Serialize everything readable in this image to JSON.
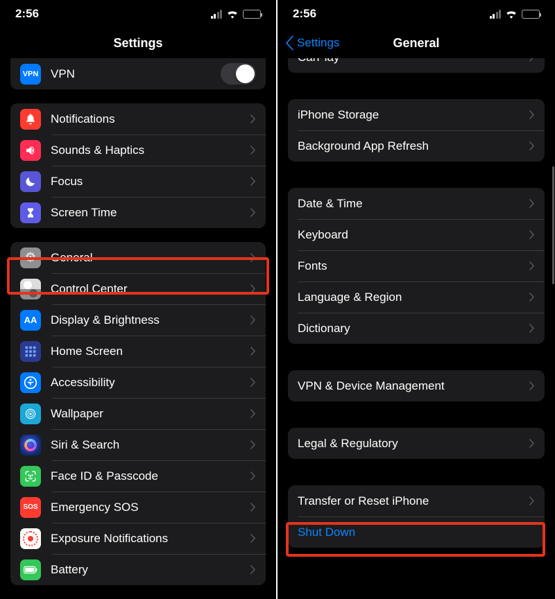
{
  "status": {
    "time": "2:56",
    "signal_level": 2,
    "wifi": true,
    "battery_pct": 45,
    "battery_color": "#ffcc00"
  },
  "left": {
    "title": "Settings",
    "vpn": {
      "label": "VPN",
      "icon_text": "VPN",
      "on": false
    },
    "groups": [
      [
        {
          "key": "notifications",
          "label": "Notifications",
          "icon": "bell-icon",
          "bg": "bg-red"
        },
        {
          "key": "sounds-haptics",
          "label": "Sounds & Haptics",
          "icon": "speaker-icon",
          "bg": "bg-pink"
        },
        {
          "key": "focus",
          "label": "Focus",
          "icon": "moon-icon",
          "bg": "bg-indigo"
        },
        {
          "key": "screen-time",
          "label": "Screen Time",
          "icon": "hourglass-icon",
          "bg": "bg-violet"
        }
      ],
      [
        {
          "key": "general",
          "label": "General",
          "icon": "gear-icon",
          "bg": "bg-gray",
          "highlighted": true
        },
        {
          "key": "control-center",
          "label": "Control Center",
          "icon": "switches-icon",
          "bg": "bg-gray"
        },
        {
          "key": "display-brightness",
          "label": "Display & Brightness",
          "icon": "text-size-icon",
          "bg": "bg-blue",
          "glyph": "AA"
        },
        {
          "key": "home-screen",
          "label": "Home Screen",
          "icon": "apps-grid-icon",
          "bg": "bg-bluealt"
        },
        {
          "key": "accessibility",
          "label": "Accessibility",
          "icon": "accessibility-icon",
          "bg": "bg-blue"
        },
        {
          "key": "wallpaper",
          "label": "Wallpaper",
          "icon": "wallpaper-icon",
          "bg": "bg-cyan"
        },
        {
          "key": "siri-search",
          "label": "Siri & Search",
          "icon": "siri-icon",
          "bg": "bg-black"
        },
        {
          "key": "face-id",
          "label": "Face ID & Passcode",
          "icon": "faceid-icon",
          "bg": "bg-green"
        },
        {
          "key": "emergency-sos",
          "label": "Emergency SOS",
          "icon": "sos-icon",
          "bg": "bg-red",
          "glyph": "SOS"
        },
        {
          "key": "exposure",
          "label": "Exposure Notifications",
          "icon": "exposure-icon",
          "bg": "bg-white"
        },
        {
          "key": "battery",
          "label": "Battery",
          "icon": "battery-icon",
          "bg": "bg-green"
        }
      ]
    ]
  },
  "right": {
    "back_label": "Settings",
    "title": "General",
    "groups": [
      [
        {
          "key": "carplay",
          "label": "CarPlay"
        }
      ],
      [
        {
          "key": "iphone-storage",
          "label": "iPhone Storage"
        },
        {
          "key": "background-app-refresh",
          "label": "Background App Refresh"
        }
      ],
      [
        {
          "key": "date-time",
          "label": "Date & Time"
        },
        {
          "key": "keyboard",
          "label": "Keyboard"
        },
        {
          "key": "fonts",
          "label": "Fonts"
        },
        {
          "key": "language-region",
          "label": "Language & Region"
        },
        {
          "key": "dictionary",
          "label": "Dictionary"
        }
      ],
      [
        {
          "key": "vpn-device-mgmt",
          "label": "VPN & Device Management"
        }
      ],
      [
        {
          "key": "legal-regulatory",
          "label": "Legal & Regulatory"
        }
      ],
      [
        {
          "key": "transfer-reset",
          "label": "Transfer or Reset iPhone"
        },
        {
          "key": "shut-down",
          "label": "Shut Down",
          "link": true,
          "no_chevron": true,
          "highlighted": true
        }
      ]
    ]
  }
}
